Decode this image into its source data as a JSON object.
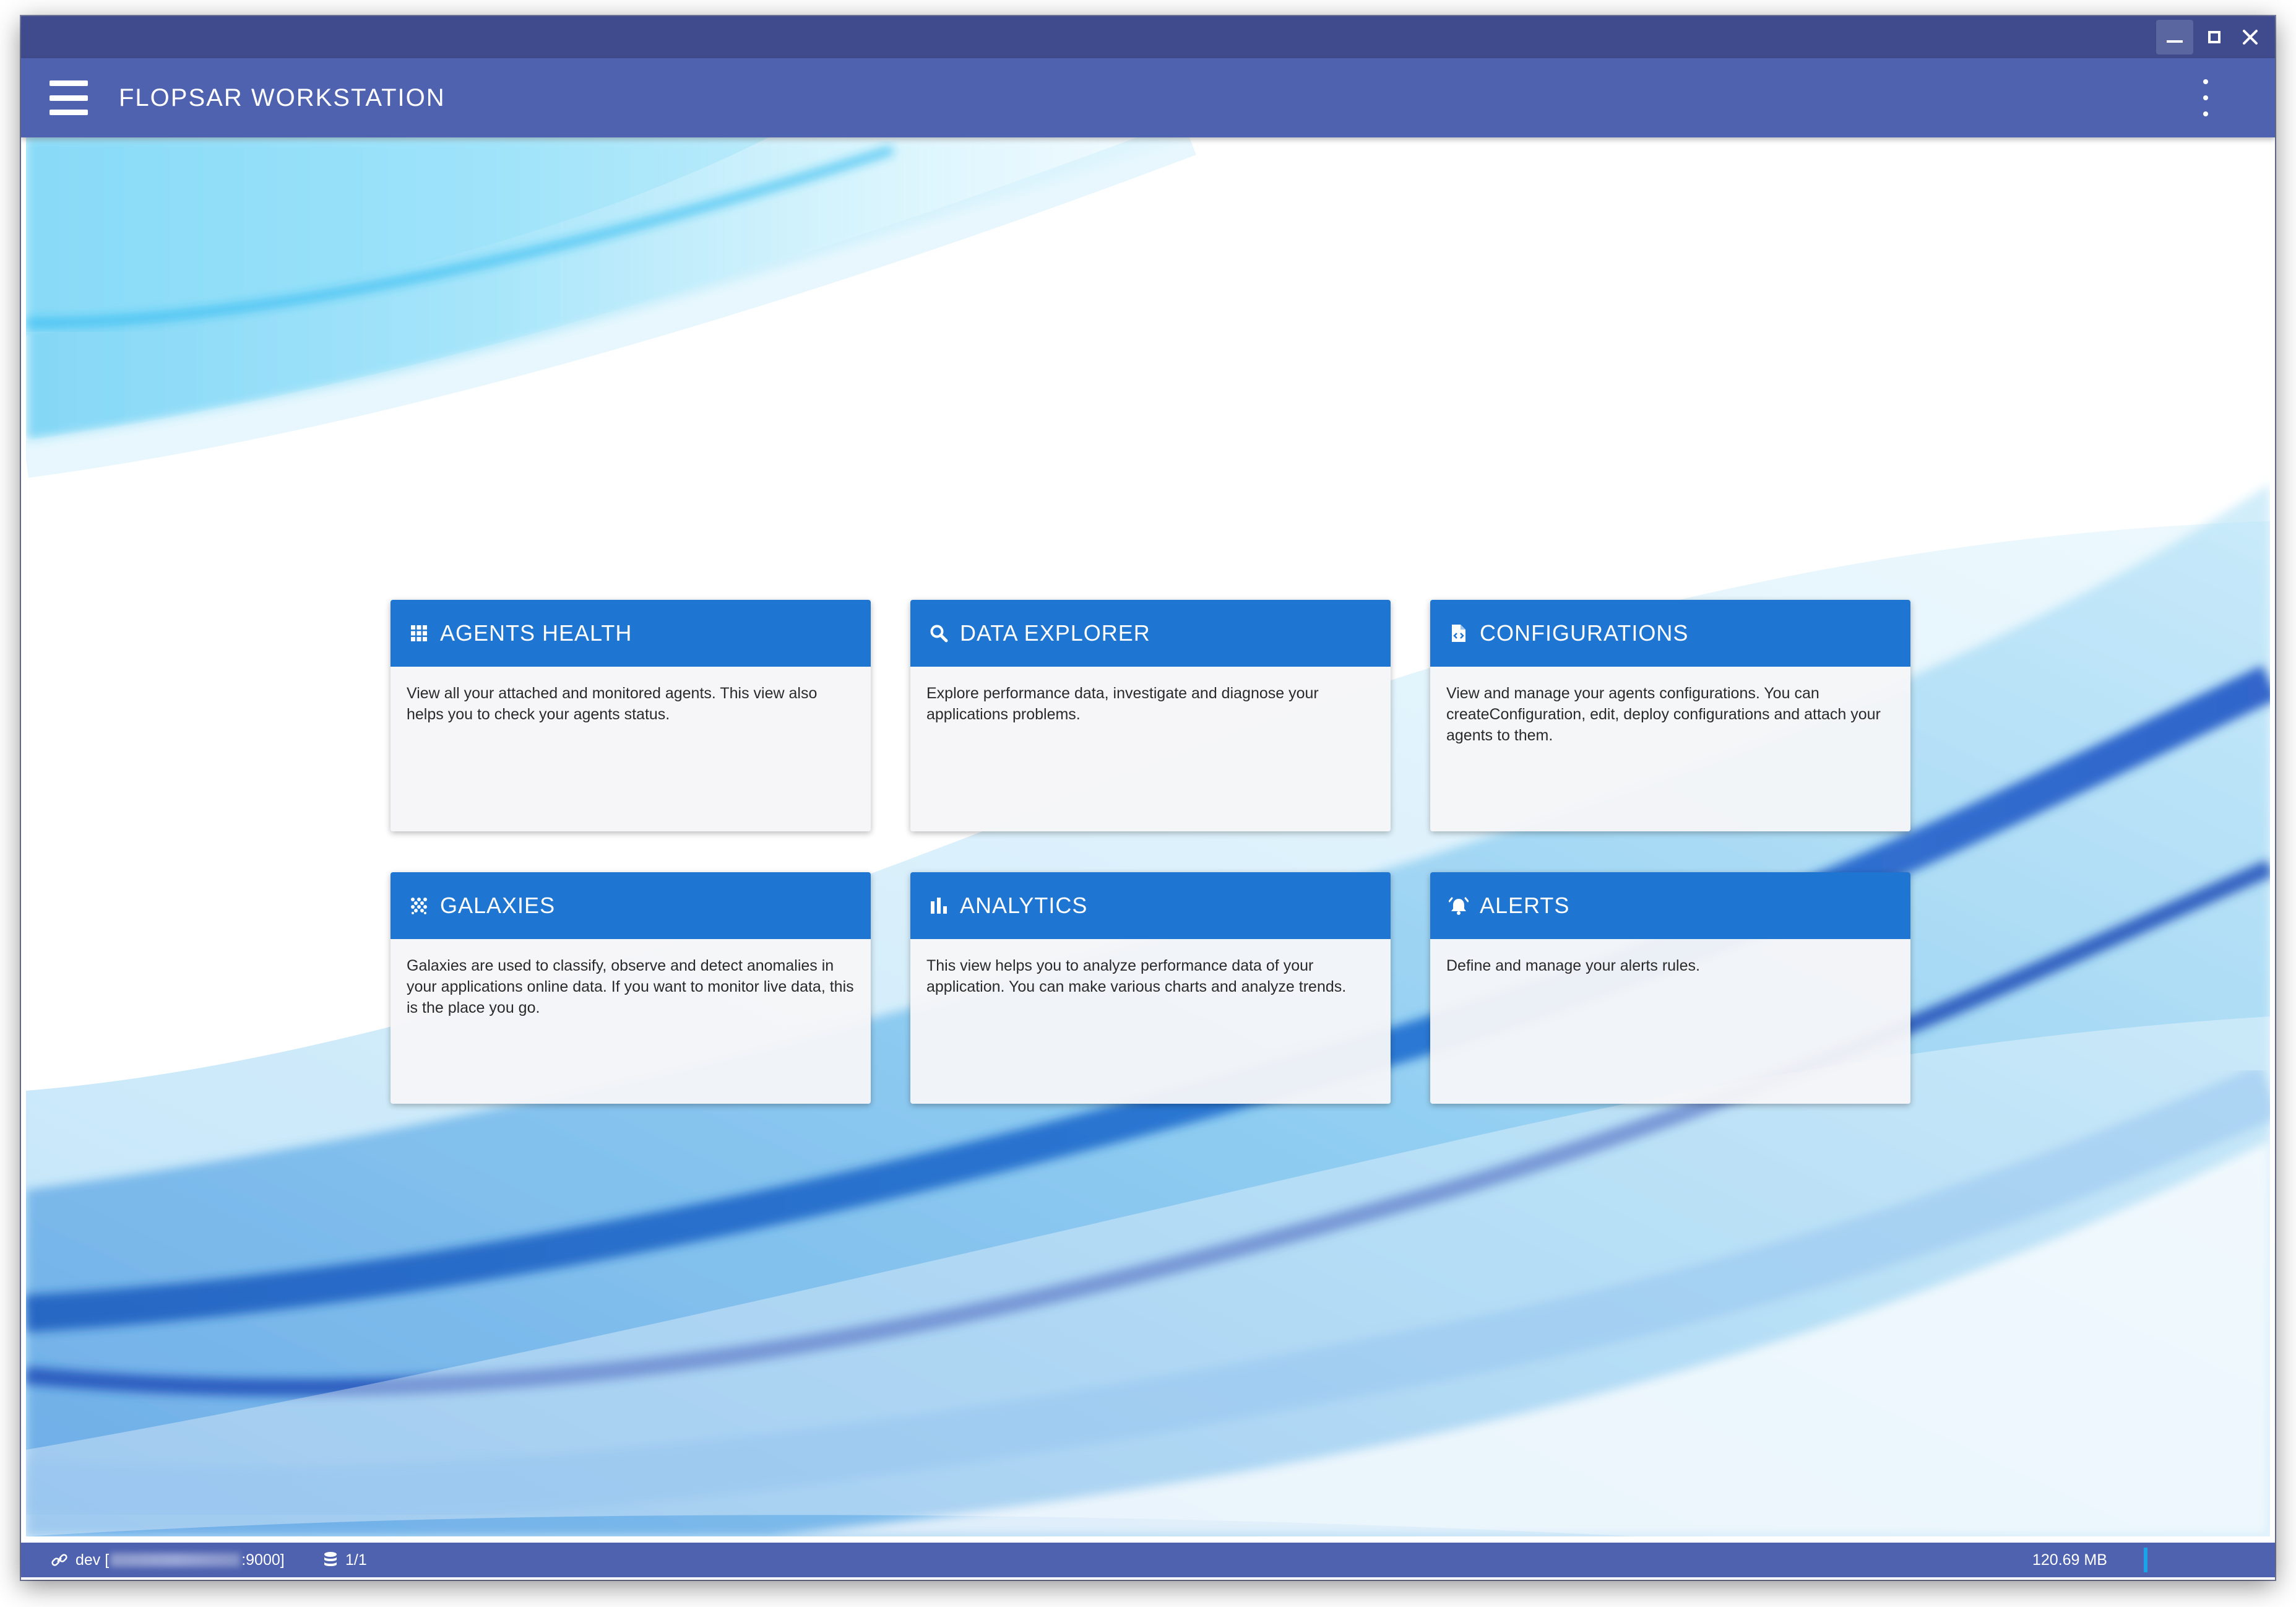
{
  "window": {
    "controls": [
      "minimize-icon",
      "maximize-icon",
      "close-icon"
    ]
  },
  "appbar": {
    "title": "FLOPSAR WORKSTATION",
    "menu_icon": "hamburger-menu-icon",
    "overflow_icon": "more-vert-icon"
  },
  "cards": [
    {
      "id": "agents-health",
      "title": "AGENTS HEALTH",
      "icon": "grid-icon",
      "description": "View all your attached and monitored agents. This view also helps you to check your agents status."
    },
    {
      "id": "data-explorer",
      "title": "DATA EXPLORER",
      "icon": "search-icon",
      "description": "Explore performance data, investigate and diagnose your applications problems."
    },
    {
      "id": "configurations",
      "title": "CONFIGURATIONS",
      "icon": "code-file-icon",
      "description": "View and manage your agents configurations. You can createConfiguration, edit, deploy configurations and attach your agents to them."
    },
    {
      "id": "galaxies",
      "title": "GALAXIES",
      "icon": "scatter-dots-icon",
      "description": "Galaxies are used to classify, observe and detect anomalies in your applications online data. If you want to monitor live data, this is the place you go."
    },
    {
      "id": "analytics",
      "title": "ANALYTICS",
      "icon": "bar-chart-icon",
      "description": "This view helps you to analyze performance data of your application. You can make various charts and analyze trends."
    },
    {
      "id": "alerts",
      "title": "ALERTS",
      "icon": "alarm-bell-icon",
      "description": "Define and manage your alerts rules."
    }
  ],
  "statusbar": {
    "connection_prefix": "dev [",
    "connection_suffix": ":9000]",
    "connection_icon": "link-icon",
    "db_icon": "database-icon",
    "db_count": "1/1",
    "memory": "120.69 MB"
  },
  "colors": {
    "titlebar": "#3f4b8c",
    "appbar": "#4f62b0",
    "card_header": "#1e75d2",
    "card_body": "#f5f6f8"
  }
}
